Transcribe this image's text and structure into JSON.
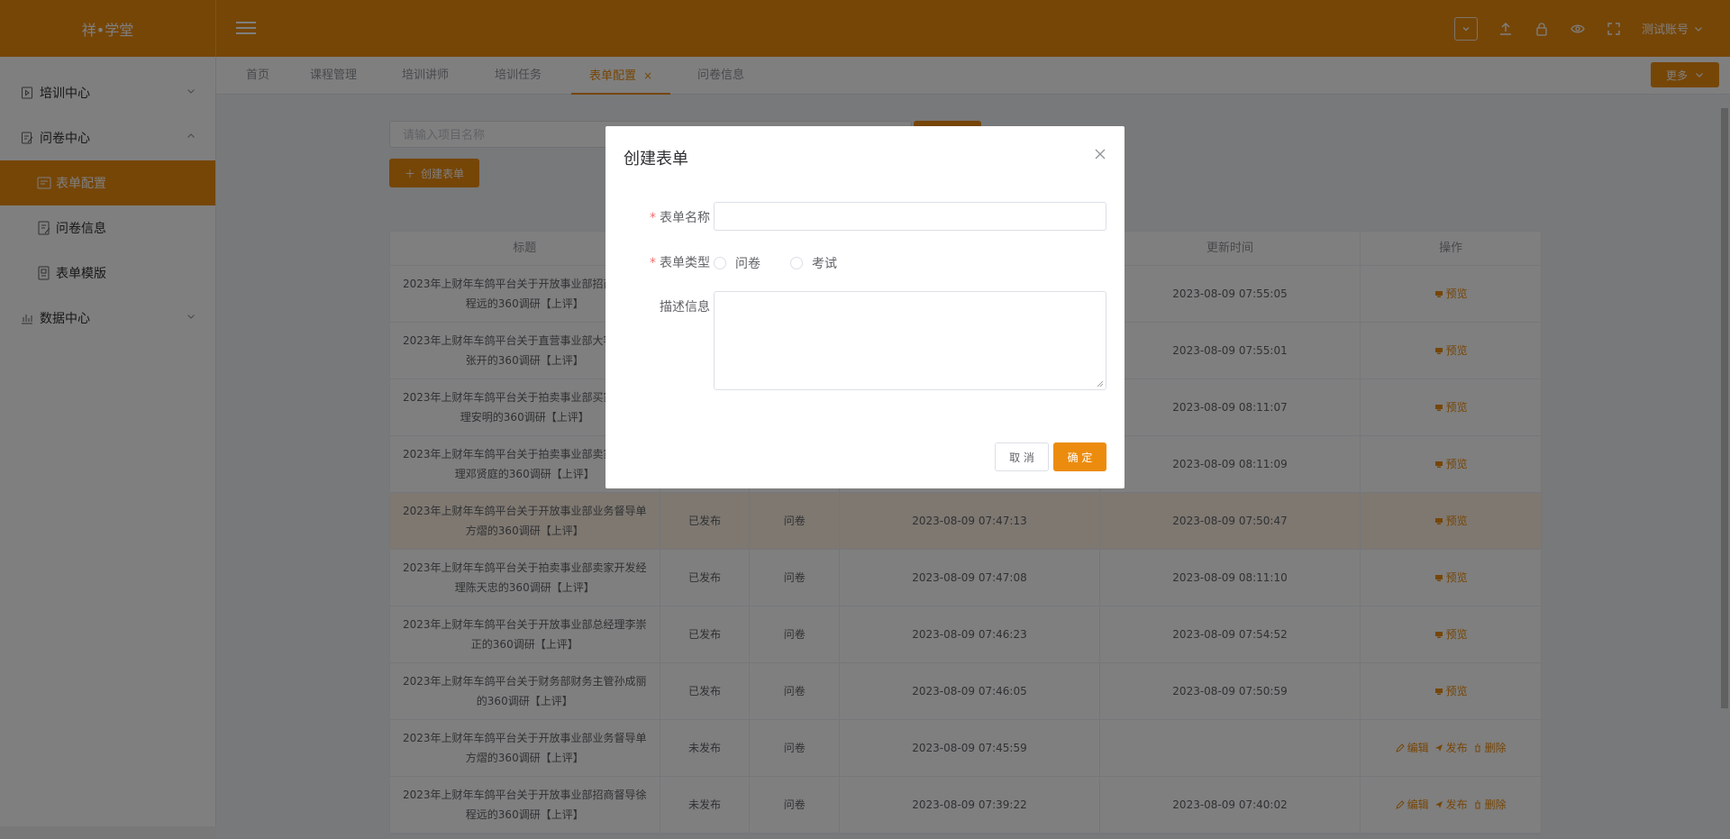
{
  "brand": "祥•学堂",
  "header": {
    "account": "测试账号",
    "icons": [
      "chevron-down-box-icon",
      "upload-icon",
      "lock-icon",
      "eye-icon",
      "fullscreen-icon"
    ]
  },
  "sidebar": {
    "items": [
      {
        "label": "培训中心",
        "icon": "play-doc-icon",
        "expanded": false
      },
      {
        "label": "问卷中心",
        "icon": "edit-doc-icon",
        "expanded": true
      },
      {
        "label": "数据中心",
        "icon": "chart-icon",
        "expanded": false
      }
    ],
    "sub_items": [
      {
        "label": "表单配置",
        "icon": "form-config-icon",
        "active": true
      },
      {
        "label": "问卷信息",
        "icon": "questionnaire-icon",
        "active": false
      },
      {
        "label": "表单模版",
        "icon": "template-icon",
        "active": false
      }
    ]
  },
  "tabs": [
    {
      "label": "首页",
      "active": false
    },
    {
      "label": "课程管理",
      "active": false
    },
    {
      "label": "培训讲师",
      "active": false
    },
    {
      "label": "培训任务",
      "active": false
    },
    {
      "label": "表单配置",
      "active": true,
      "closable": true
    },
    {
      "label": "问卷信息",
      "active": false
    }
  ],
  "more_label": "更多",
  "search": {
    "placeholder": "请输入项目名称"
  },
  "create_label": "创建表单",
  "table": {
    "headers": [
      "标题",
      "",
      "",
      "",
      "更新时间",
      "操作"
    ],
    "rows": [
      {
        "title": "2023年上财年车鸽平台关于开放事业部招商督导徐程远的360调研【上评】",
        "status": "",
        "type": "",
        "created": "",
        "updated": "2023-08-09 07:55:05",
        "ops": [
          "预览"
        ]
      },
      {
        "title": "2023年上财年车鸽平台关于直营事业部大客户经理张开的360调研【上评】",
        "status": "",
        "type": "",
        "created": "",
        "updated": "2023-08-09 07:55:01",
        "ops": [
          "预览"
        ]
      },
      {
        "title": "2023年上财年车鸽平台关于拍卖事业部买家开发经理安明的360调研【上评】",
        "status": "",
        "type": "",
        "created": "",
        "updated": "2023-08-09 08:11:07",
        "ops": [
          "预览"
        ]
      },
      {
        "title": "2023年上财年车鸽平台关于拍卖事业部卖家开发经理邓贤庭的360调研【上评】",
        "status": "",
        "type": "",
        "created": "",
        "updated": "2023-08-09 08:11:09",
        "ops": [
          "预览"
        ]
      },
      {
        "title": "2023年上财年车鸽平台关于开放事业部业务督导单方熠的360调研【上评】",
        "status": "已发布",
        "type": "问卷",
        "created": "2023-08-09 07:47:13",
        "updated": "2023-08-09 07:50:47",
        "ops": [
          "预览"
        ],
        "highlight": true
      },
      {
        "title": "2023年上财年车鸽平台关于拍卖事业部卖家开发经理陈天忠的360调研【上评】",
        "status": "已发布",
        "type": "问卷",
        "created": "2023-08-09 07:47:08",
        "updated": "2023-08-09 08:11:10",
        "ops": [
          "预览"
        ]
      },
      {
        "title": "2023年上财年车鸽平台关于开放事业部总经理李崇正的360调研【上评】",
        "status": "已发布",
        "type": "问卷",
        "created": "2023-08-09 07:46:23",
        "updated": "2023-08-09 07:54:52",
        "ops": [
          "预览"
        ]
      },
      {
        "title": "2023年上财年车鸽平台关于财务部财务主管孙成丽的360调研【上评】",
        "status": "已发布",
        "type": "问卷",
        "created": "2023-08-09 07:46:05",
        "updated": "2023-08-09 07:50:59",
        "ops": [
          "预览"
        ]
      },
      {
        "title": "2023年上财年车鸽平台关于开放事业部业务督导单方熠的360调研【上评】",
        "status": "未发布",
        "type": "问卷",
        "created": "2023-08-09 07:45:59",
        "updated": "",
        "ops": [
          "编辑",
          "发布",
          "删除"
        ]
      },
      {
        "title": "2023年上财年车鸽平台关于开放事业部招商督导徐程远的360调研【上评】",
        "status": "未发布",
        "type": "问卷",
        "created": "2023-08-09 07:39:22",
        "updated": "2023-08-09 07:40:02",
        "ops": [
          "编辑",
          "发布",
          "删除"
        ]
      }
    ]
  },
  "modal": {
    "title": "创建表单",
    "name_label": "表单名称",
    "name_value": "",
    "type_label": "表单类型",
    "type_options": [
      "问卷",
      "考试"
    ],
    "desc_label": "描述信息",
    "desc_value": "",
    "cancel_label": "取 消",
    "ok_label": "确 定"
  },
  "colors": {
    "accent": "#ec8c0e",
    "required": "#f56c6c"
  }
}
